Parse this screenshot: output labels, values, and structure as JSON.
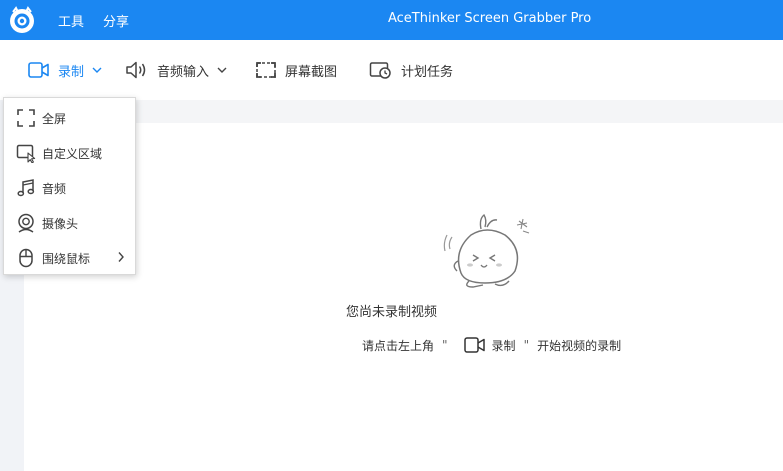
{
  "titlebar": {
    "menu": [
      "工具",
      "分享"
    ],
    "app_title": "AceThinker Screen Grabber Pro"
  },
  "toolbar": {
    "record": "录制",
    "audio_input": "音频输入",
    "screenshot": "屏幕截图",
    "schedule": "计划任务"
  },
  "dropdown": {
    "items": [
      {
        "label": "全屏",
        "icon": "fullscreen-icon"
      },
      {
        "label": "自定义区域",
        "icon": "custom-region-icon"
      },
      {
        "label": "音频",
        "icon": "music-note-icon"
      },
      {
        "label": "摄像头",
        "icon": "webcam-icon"
      },
      {
        "label": "围绕鼠标",
        "icon": "mouse-icon"
      }
    ]
  },
  "empty_state": {
    "title": "您尚未录制视频",
    "hint_prefix": "请点击左上角",
    "hint_quote_open": "\"",
    "hint_record": "录制",
    "hint_quote_close": "\"",
    "hint_suffix": "开始视频的录制"
  },
  "colors": {
    "accent": "#1b87f2",
    "text": "#333333",
    "icon": "#444444"
  }
}
